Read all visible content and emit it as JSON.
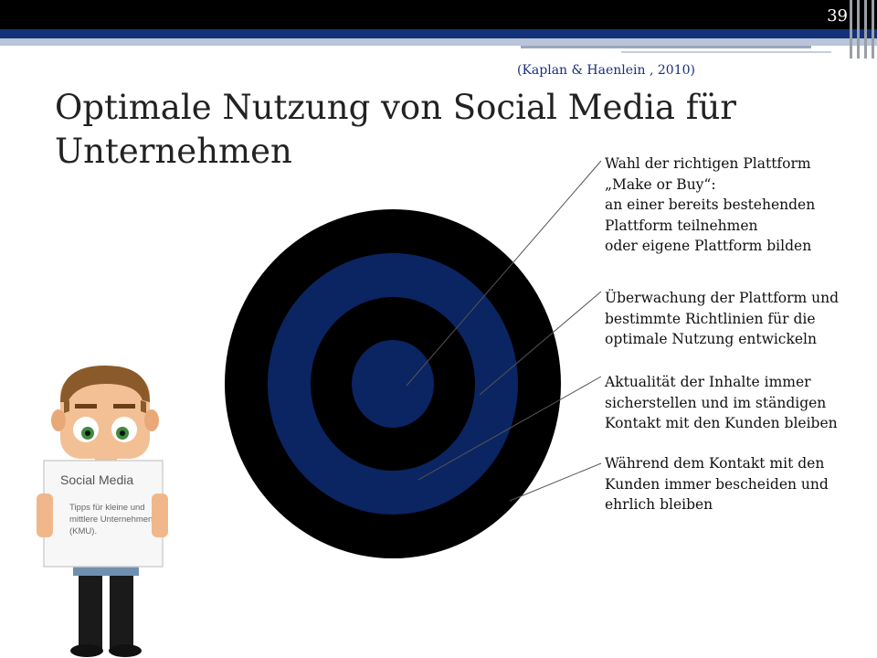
{
  "page_number": "39",
  "citation": "(Kaplan & Haenlein , 2010)",
  "title": "Optimale Nutzung von Social Media für Unternehmen",
  "callouts": [
    {
      "lines": [
        "Wahl der richtigen Plattform",
        "„Make or Buy“:",
        "an einer bereits bestehenden",
        "Plattform teilnehmen",
        "oder eigene Plattform bilden"
      ]
    },
    {
      "lines": [
        "Überwachung der Plattform und",
        "bestimmte Richtlinien für die",
        "optimale Nutzung entwickeln"
      ]
    },
    {
      "lines": [
        "Aktualität der Inhalte immer",
        "sicherstellen und im ständigen",
        "Kontakt mit den Kunden bleiben"
      ]
    },
    {
      "lines": [
        "Während dem Kontakt mit den",
        "Kunden immer bescheiden und",
        "ehrlich bleiben"
      ]
    }
  ],
  "sign": {
    "title": "Social Media",
    "subtitle_lines": [
      "Tipps für kleine und",
      "mittlere Unternehmen",
      "(KMU)."
    ]
  },
  "colors": {
    "ring_black": "#000000",
    "ring_blue": "#0b2462",
    "header_blue": "#14327a"
  }
}
